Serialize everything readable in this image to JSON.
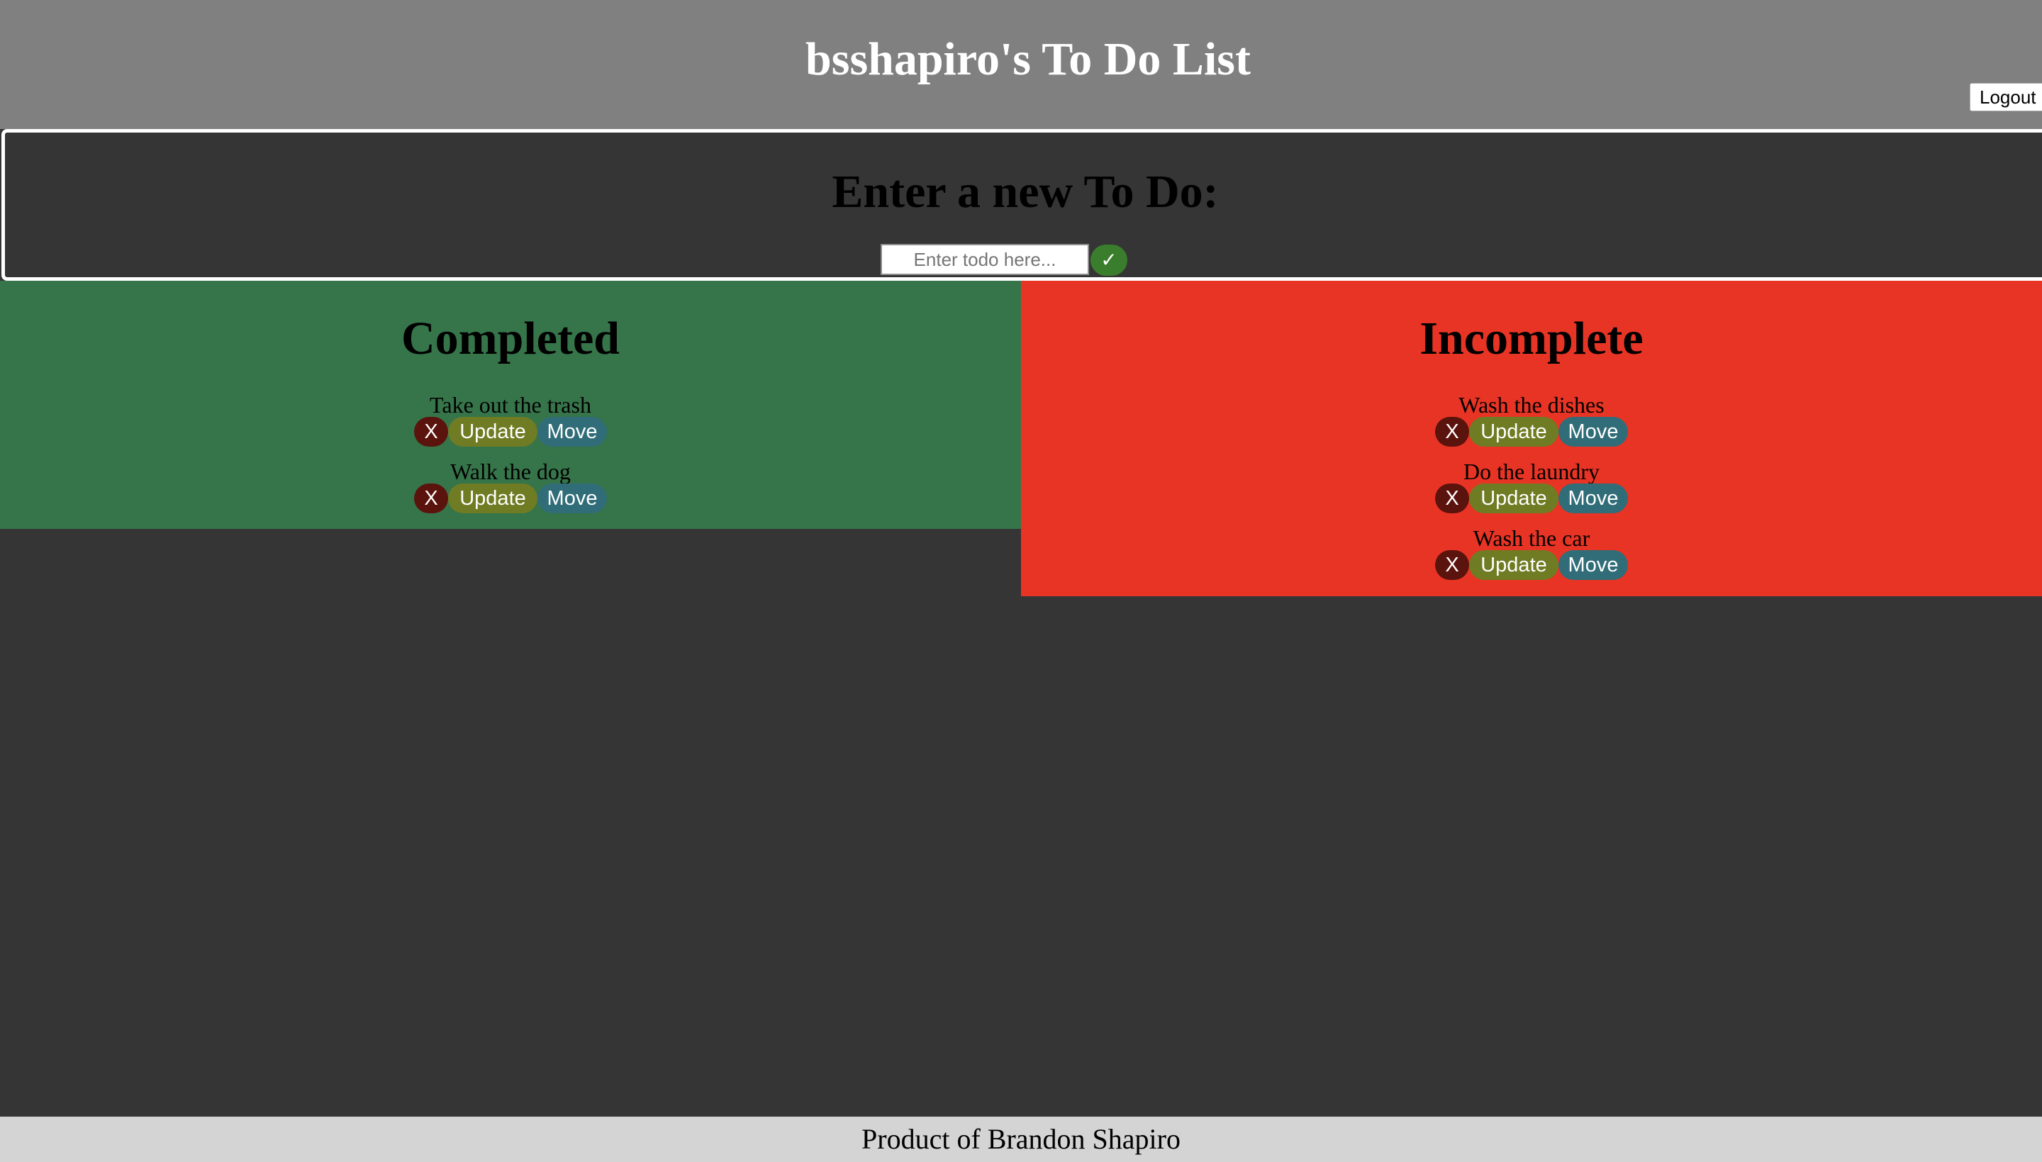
{
  "header": {
    "title": "bsshapiro's To Do List",
    "logout_label": "Logout"
  },
  "new_todo": {
    "heading": "Enter a new To Do:",
    "placeholder": "Enter todo here...",
    "submit_label": "✓"
  },
  "item_actions": {
    "delete_label": "X",
    "update_label": "Update",
    "move_label": "Move"
  },
  "completed": {
    "heading": "Completed",
    "items": [
      {
        "text": "Take out the trash"
      },
      {
        "text": "Walk the dog"
      }
    ]
  },
  "incomplete": {
    "heading": "Incomplete",
    "items": [
      {
        "text": "Wash the dishes"
      },
      {
        "text": "Do the laundry"
      },
      {
        "text": "Wash the car"
      }
    ]
  },
  "footer": {
    "text": "Product of Brandon Shapiro"
  },
  "colors": {
    "header_bg": "#808080",
    "page_bg": "#353535",
    "completed_bg": "#36744a",
    "incomplete_bg": "#e83424",
    "submit_green": "#3a7d2c",
    "delete_bg": "#5b130d",
    "update_bg": "#6f7c23",
    "move_bg": "#306d78",
    "footer_bg": "#d4d4d4"
  }
}
